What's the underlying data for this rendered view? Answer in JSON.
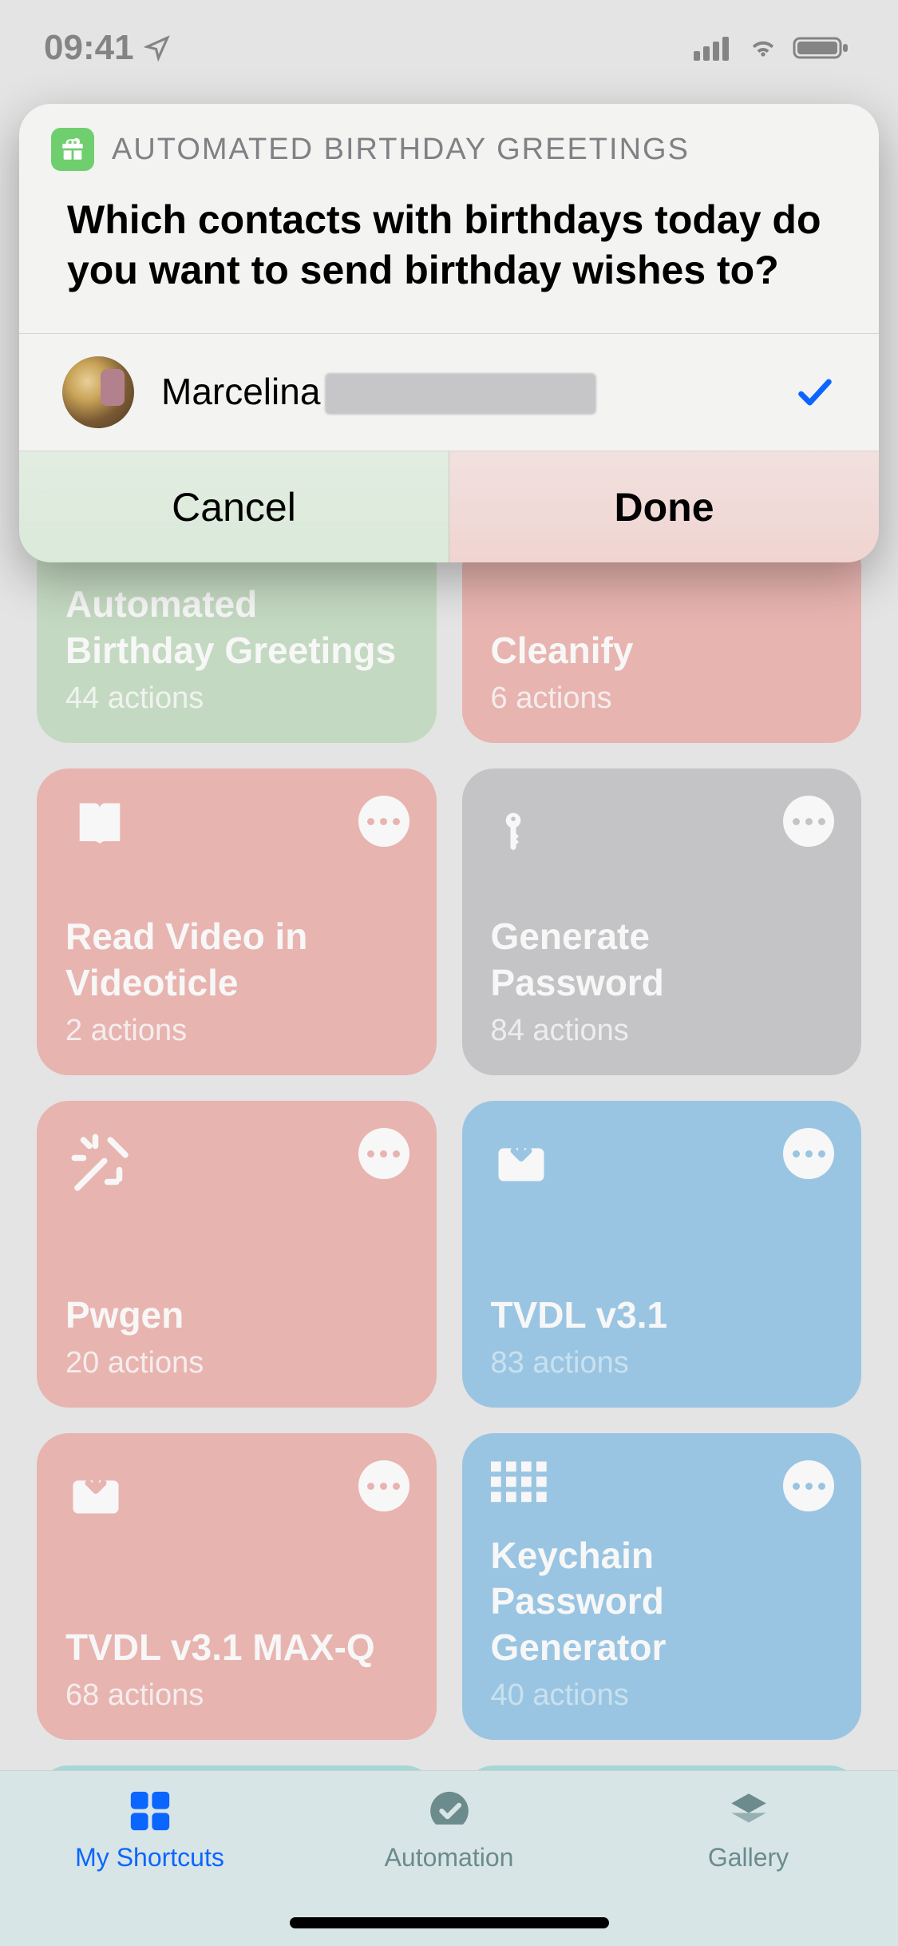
{
  "status": {
    "time": "09:41"
  },
  "prompt": {
    "app_name": "AUTOMATED BIRTHDAY GREETINGS",
    "question": "Which contacts with birthdays today do you want to send birthday wishes to?",
    "contacts": [
      {
        "name_first": "Marcelina",
        "selected": true
      }
    ],
    "cancel_label": "Cancel",
    "done_label": "Done"
  },
  "shortcuts": [
    {
      "title": "Automated Birthday Greetings",
      "actions": "44 actions",
      "color": "green",
      "icon": "gift",
      "short": true
    },
    {
      "title": "Cleanify",
      "actions": "6 actions",
      "color": "red",
      "icon": "none",
      "short": true
    },
    {
      "title": "Read Video in Videoticle",
      "actions": "2 actions",
      "color": "red",
      "icon": "book"
    },
    {
      "title": "Generate Password",
      "actions": "84 actions",
      "color": "gray",
      "icon": "key"
    },
    {
      "title": "Pwgen",
      "actions": "20 actions",
      "color": "red",
      "icon": "wand"
    },
    {
      "title": "TVDL v3.1",
      "actions": "83 actions",
      "color": "blue",
      "icon": "download"
    },
    {
      "title": "TVDL v3.1 MAX-Q",
      "actions": "68 actions",
      "color": "red",
      "icon": "download"
    },
    {
      "title": "Keychain Password Generator",
      "actions": "40 actions",
      "color": "blue",
      "icon": "grid"
    },
    {
      "title": "",
      "actions": "",
      "color": "teal",
      "icon": "washer",
      "short": false
    },
    {
      "title": "",
      "actions": "",
      "color": "teal",
      "icon": "camera",
      "short": false
    }
  ],
  "tabs": {
    "my_shortcuts": "My Shortcuts",
    "automation": "Automation",
    "gallery": "Gallery"
  }
}
